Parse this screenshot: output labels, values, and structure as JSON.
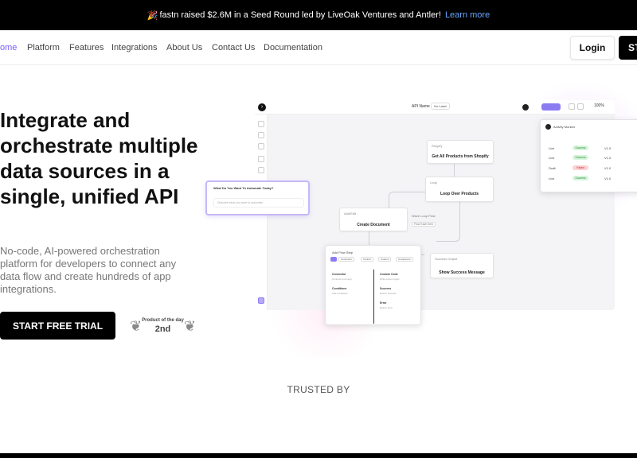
{
  "banner": {
    "emoji": "🎉",
    "text": "fastn raised $2.6M in a Seed Round led by LiveOak Ventures and Antler!",
    "link": "Learn more"
  },
  "nav": {
    "items": [
      "ome",
      "Platform",
      "Features",
      "Integrations",
      "About Us",
      "Contact Us",
      "Documentation"
    ],
    "login": "Login",
    "start": "ST"
  },
  "hero": {
    "title": "Integrate and orchestrate multiple data sources in a single, unified API",
    "subtitle": "No-code, AI-powered orchestration platform for developers to connect any data flow and create hundreds of app integrations.",
    "cta": "START FREE TRIAL",
    "badge_line1": "Product of the day",
    "badge_line2": "2nd"
  },
  "app": {
    "api_name_label": "API Name",
    "api_name_value": "No Label",
    "zoom": "100%",
    "prompt_question": "What Do You Want To Automate Today?",
    "prompt_placeholder": "Describe what you want to automate...",
    "nodes": {
      "shopify_tag": "Shopify",
      "shopify_title": "Get All Products from Shopify",
      "loop_tag": "Loop",
      "loop_title": "Loop Over Products",
      "create_tag": "Add/Edit",
      "create_title": "Create Document",
      "success_tag": "Success Output",
      "success_title": "Show Success Message",
      "flow_label": "Wave Loop Flow",
      "flow_val": "Flow Each Item"
    },
    "table": {
      "header": "Activity Monitor",
      "rows": [
        {
          "method": "Live",
          "status": "Success",
          "version": "V1.0",
          "kind": "ok"
        },
        {
          "method": "Live",
          "status": "Success",
          "version": "V1.0",
          "kind": "ok"
        },
        {
          "method": "Draft",
          "status": "Failed",
          "version": "V1.0",
          "kind": "bad"
        },
        {
          "method": "Live",
          "status": "Success",
          "version": "V1.0",
          "kind": "ok"
        }
      ]
    },
    "flow_card": {
      "title": "Add Flow Step",
      "chips": [
        "Connector",
        "Control",
        "Custom",
        "Component"
      ],
      "items": [
        {
          "label": "Connector",
          "sub": "Connect to an app"
        },
        {
          "label": "Custom Code",
          "sub": "Write custom logic"
        },
        {
          "label": "Conditions",
          "sub": "Add conditions"
        },
        {
          "label": "Success",
          "sub": "Return success"
        },
        {
          "label": "Error",
          "sub": "Return error"
        }
      ]
    }
  },
  "trusted": "TRUSTED BY"
}
